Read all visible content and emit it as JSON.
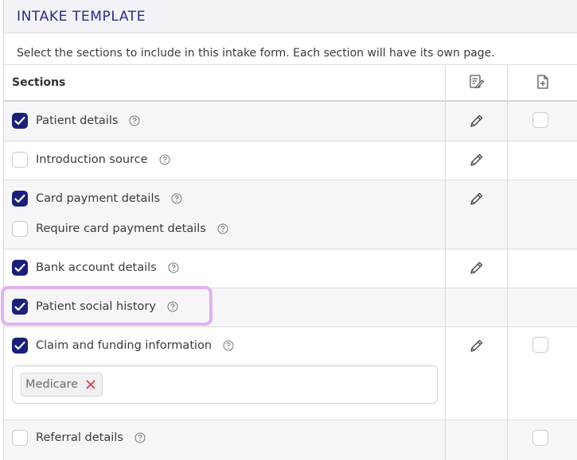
{
  "header": {
    "title": "INTAKE TEMPLATE"
  },
  "description": "Select the sections to include in this intake form. Each section will have its own page.",
  "grid": {
    "sections_label": "Sections",
    "edit_column_icon": "edit-form-icon",
    "add_column_icon": "add-document-icon"
  },
  "sections": {
    "patient_details": {
      "label": "Patient details",
      "checked": true
    },
    "introduction_source": {
      "label": "Introduction source",
      "checked": false
    },
    "card_payment": {
      "label": "Card payment details",
      "checked": true
    },
    "require_card": {
      "label": "Require card payment details",
      "checked": false
    },
    "bank_account": {
      "label": "Bank account details",
      "checked": true
    },
    "social_history": {
      "label": "Patient social history",
      "checked": true
    },
    "claim_funding": {
      "label": "Claim and funding information",
      "checked": true
    },
    "referral": {
      "label": "Referral details",
      "checked": false
    }
  },
  "funding_tags": [
    {
      "label": "Medicare",
      "remove_icon": "close-icon"
    }
  ],
  "colors": {
    "accent": "#1a1f7a",
    "title": "#2a2a8a",
    "highlight": "#e0b2ef",
    "remove": "#d93a4a"
  }
}
